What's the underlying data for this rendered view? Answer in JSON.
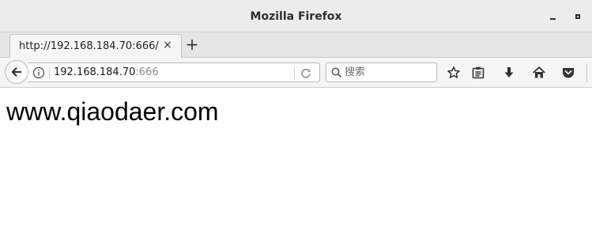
{
  "window": {
    "title": "Mozilla Firefox"
  },
  "tabs": [
    {
      "label": "http://192.168.184.70:666/",
      "active": true
    }
  ],
  "toolbar": {
    "new_tab_label": "+",
    "tab_close_label": "×"
  },
  "urlbar": {
    "host": "192.168.184.70",
    "port": ":666"
  },
  "search": {
    "placeholder": "搜索"
  },
  "icons": {
    "back": "back-arrow-icon",
    "info": "info-icon",
    "reload": "reload-icon",
    "search": "search-icon",
    "bookmark": "star-icon",
    "library": "library-icon",
    "download": "download-icon",
    "home": "home-icon",
    "pocket": "pocket-icon"
  },
  "page": {
    "heading": "www.qiaodaer.com"
  },
  "colors": {
    "titlebar": "#ececec",
    "toolbar": "#f5f5f5",
    "text": "#000000"
  }
}
